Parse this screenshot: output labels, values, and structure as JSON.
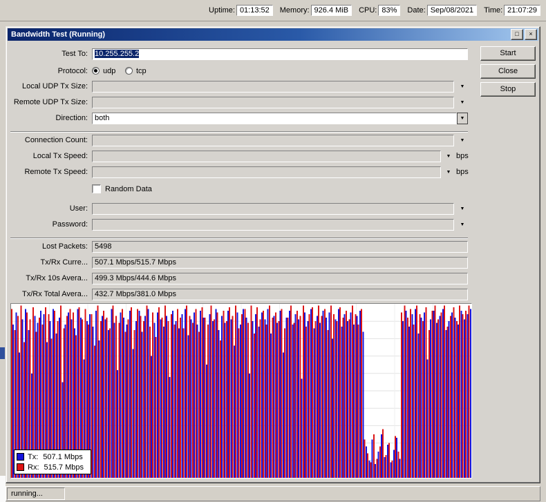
{
  "system_bar": {
    "items": [
      {
        "label": "Uptime:",
        "value": "01:13:52"
      },
      {
        "label": "Memory:",
        "value": "926.4 MiB"
      },
      {
        "label": "CPU:",
        "value": "83%"
      },
      {
        "label": "Date:",
        "value": "Sep/08/2021"
      },
      {
        "label": "Time:",
        "value": "21:07:29"
      }
    ]
  },
  "window": {
    "title": "Bandwidth Test (Running)"
  },
  "icons": {
    "dropdown_icon": "▼",
    "combo_icon": "▼",
    "restore_icon": "□",
    "close_icon": "×"
  },
  "form": {
    "test_to": {
      "label": "Test To:",
      "value": "10.255.255.2"
    },
    "protocol": {
      "label": "Protocol:",
      "options": [
        "udp",
        "tcp"
      ],
      "selected": "udp"
    },
    "local_udp_tx_size": {
      "label": "Local UDP Tx Size:",
      "value": ""
    },
    "remote_udp_tx_size": {
      "label": "Remote UDP Tx Size:",
      "value": ""
    },
    "direction": {
      "label": "Direction:",
      "value": "both"
    },
    "connection_count": {
      "label": "Connection Count:",
      "value": ""
    },
    "local_tx_speed": {
      "label": "Local Tx Speed:",
      "value": "",
      "unit": "bps"
    },
    "remote_tx_speed": {
      "label": "Remote Tx Speed:",
      "value": "",
      "unit": "bps"
    },
    "random_data": {
      "label": "Random Data",
      "checked": false
    },
    "user": {
      "label": "User:",
      "value": ""
    },
    "password": {
      "label": "Password:",
      "value": ""
    }
  },
  "stats": {
    "lost_packets": {
      "label": "Lost Packets:",
      "value": "5498"
    },
    "txrx_current": {
      "label": "Tx/Rx Curre...",
      "value": "507.1 Mbps/515.7 Mbps"
    },
    "txrx_10s_avg": {
      "label": "Tx/Rx 10s Avera...",
      "value": "499.3 Mbps/444.6 Mbps"
    },
    "txrx_total_avg": {
      "label": "Tx/Rx Total Avera...",
      "value": "432.7 Mbps/381.0 Mbps"
    }
  },
  "buttons": {
    "start": "Start",
    "close": "Close",
    "stop": "Stop"
  },
  "status_bar": {
    "text": "running..."
  },
  "colors": {
    "titlebar_start": "#0a246a",
    "titlebar_end": "#a6caf0",
    "selection": "#0a246a",
    "tx": "#1414dc",
    "rx": "#dc1414"
  },
  "chart_data": {
    "type": "bar",
    "title": "",
    "ylim": [
      0,
      100
    ],
    "grid": true,
    "legend_position": "bottom-left",
    "legend": [
      {
        "label": "Tx:",
        "value": "507.1 Mbps",
        "color": "#1414dc"
      },
      {
        "label": "Rx:",
        "value": "515.7 Mbps",
        "color": "#dc1414"
      }
    ],
    "series": [
      {
        "name": "Tx",
        "color": "#1414dc",
        "values": [
          88,
          95,
          72,
          91,
          97,
          85,
          60,
          93,
          89,
          96,
          94,
          78,
          90,
          97,
          83,
          92,
          55,
          88,
          95,
          91,
          86,
          97,
          92,
          68,
          90,
          94,
          87,
          96,
          79,
          93,
          91,
          85,
          97,
          89,
          62,
          95,
          92,
          88,
          96,
          74,
          90,
          96,
          84,
          93,
          97,
          70,
          89,
          95,
          91,
          87,
          93,
          58,
          96,
          90,
          86,
          94,
          97,
          82,
          91,
          95,
          88,
          96,
          92,
          65,
          94,
          90,
          97,
          85,
          93,
          89,
          96,
          91,
          76,
          95,
          88,
          97,
          92,
          60,
          90,
          94,
          87,
          95,
          91,
          97,
          83,
          93,
          89,
          96,
          72,
          92,
          96,
          88,
          94,
          91,
          57,
          95,
          90,
          97,
          86,
          93,
          89,
          96,
          92,
          95,
          80,
          91,
          97,
          87,
          94,
          90,
          95,
          88,
          93,
          96,
          84,
          18,
          10,
          22,
          8,
          15,
          25,
          12,
          19,
          9,
          16,
          23,
          11,
          90,
          96,
          87,
          94,
          97,
          83,
          92,
          95,
          68,
          91,
          96,
          89,
          93,
          97,
          85,
          90,
          95,
          92,
          88,
          96,
          91,
          94,
          97
        ]
      },
      {
        "name": "Rx",
        "color": "#dc1414",
        "values": [
          97,
          85,
          93,
          99,
          78,
          95,
          91,
          98,
          84,
          92,
          88,
          98,
          94,
          80,
          96,
          90,
          99,
          86,
          93,
          97,
          95,
          82,
          98,
          91,
          97,
          88,
          94,
          76,
          99,
          90,
          96,
          92,
          86,
          99,
          93,
          89,
          97,
          84,
          91,
          98,
          85,
          97,
          93,
          90,
          99,
          87,
          95,
          81,
          98,
          92,
          99,
          90,
          94,
          88,
          97,
          92,
          86,
          99,
          93,
          89,
          97,
          84,
          98,
          92,
          88,
          99,
          91,
          95,
          79,
          96,
          90,
          98,
          93,
          99,
          86,
          94,
          97,
          89,
          99,
          83,
          98,
          91,
          96,
          88,
          99,
          92,
          95,
          90,
          97,
          86,
          92,
          99,
          89,
          96,
          93,
          99,
          87,
          94,
          98,
          90,
          99,
          93,
          97,
          85,
          99,
          94,
          90,
          98,
          92,
          96,
          91,
          99,
          94,
          88,
          97,
          22,
          14,
          9,
          25,
          11,
          18,
          28,
          13,
          20,
          10,
          24,
          15,
          95,
          99,
          92,
          97,
          88,
          99,
          94,
          90,
          98,
          85,
          96,
          99,
          91,
          95,
          99,
          87,
          93,
          98,
          90,
          99,
          94,
          96,
          99
        ]
      }
    ]
  }
}
